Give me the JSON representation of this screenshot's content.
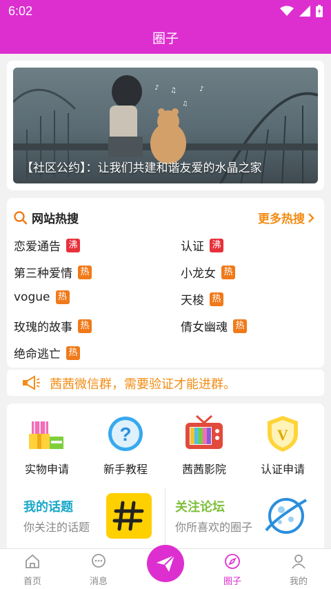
{
  "status": {
    "time": "6:02"
  },
  "header": {
    "title": "圈子"
  },
  "banner": {
    "caption": "【社区公约】：让我们共建和谐友爱的水晶之家"
  },
  "hot_search": {
    "title": "网站热搜",
    "more": "更多热搜",
    "items": [
      {
        "label": "恋爱通告",
        "tag": "沸",
        "tag_color": "#e8303b"
      },
      {
        "label": "认证",
        "tag": "沸",
        "tag_color": "#e8303b"
      },
      {
        "label": "第三种爱情",
        "tag": "热",
        "tag_color": "#f07a1a"
      },
      {
        "label": "小龙女",
        "tag": "热",
        "tag_color": "#f07a1a"
      },
      {
        "label": "vogue",
        "tag": "热",
        "tag_color": "#f07a1a"
      },
      {
        "label": "天梭",
        "tag": "热",
        "tag_color": "#f07a1a"
      },
      {
        "label": "玫瑰的故事",
        "tag": "热",
        "tag_color": "#f07a1a"
      },
      {
        "label": "倩女幽魂",
        "tag": "热",
        "tag_color": "#f07a1a"
      },
      {
        "label": "绝命逃亡",
        "tag": "热",
        "tag_color": "#f07a1a"
      }
    ]
  },
  "notice": {
    "text": "茜茜微信群，需要验证才能进群。"
  },
  "grid": {
    "items": [
      {
        "label": "实物申请",
        "icon": "gift-icon"
      },
      {
        "label": "新手教程",
        "icon": "question-icon"
      },
      {
        "label": "茜茜影院",
        "icon": "tv-icon"
      },
      {
        "label": "认证申请",
        "icon": "shield-v-icon"
      }
    ],
    "my_topics": {
      "title": "我的话题",
      "subtitle": "你关注的话题"
    },
    "follow_forum": {
      "title": "关注论坛",
      "subtitle": "你所喜欢的圈子"
    }
  },
  "nav": {
    "items": [
      {
        "label": "首页",
        "icon": "home-icon"
      },
      {
        "label": "消息",
        "icon": "message-icon"
      },
      {
        "label": "圈子",
        "icon": "compass-icon",
        "active": true
      },
      {
        "label": "我的",
        "icon": "user-icon"
      }
    ]
  },
  "colors": {
    "accent": "#dd2fd0",
    "hot": "#f07a1a",
    "boil": "#e8303b",
    "notice": "#f28c14"
  }
}
